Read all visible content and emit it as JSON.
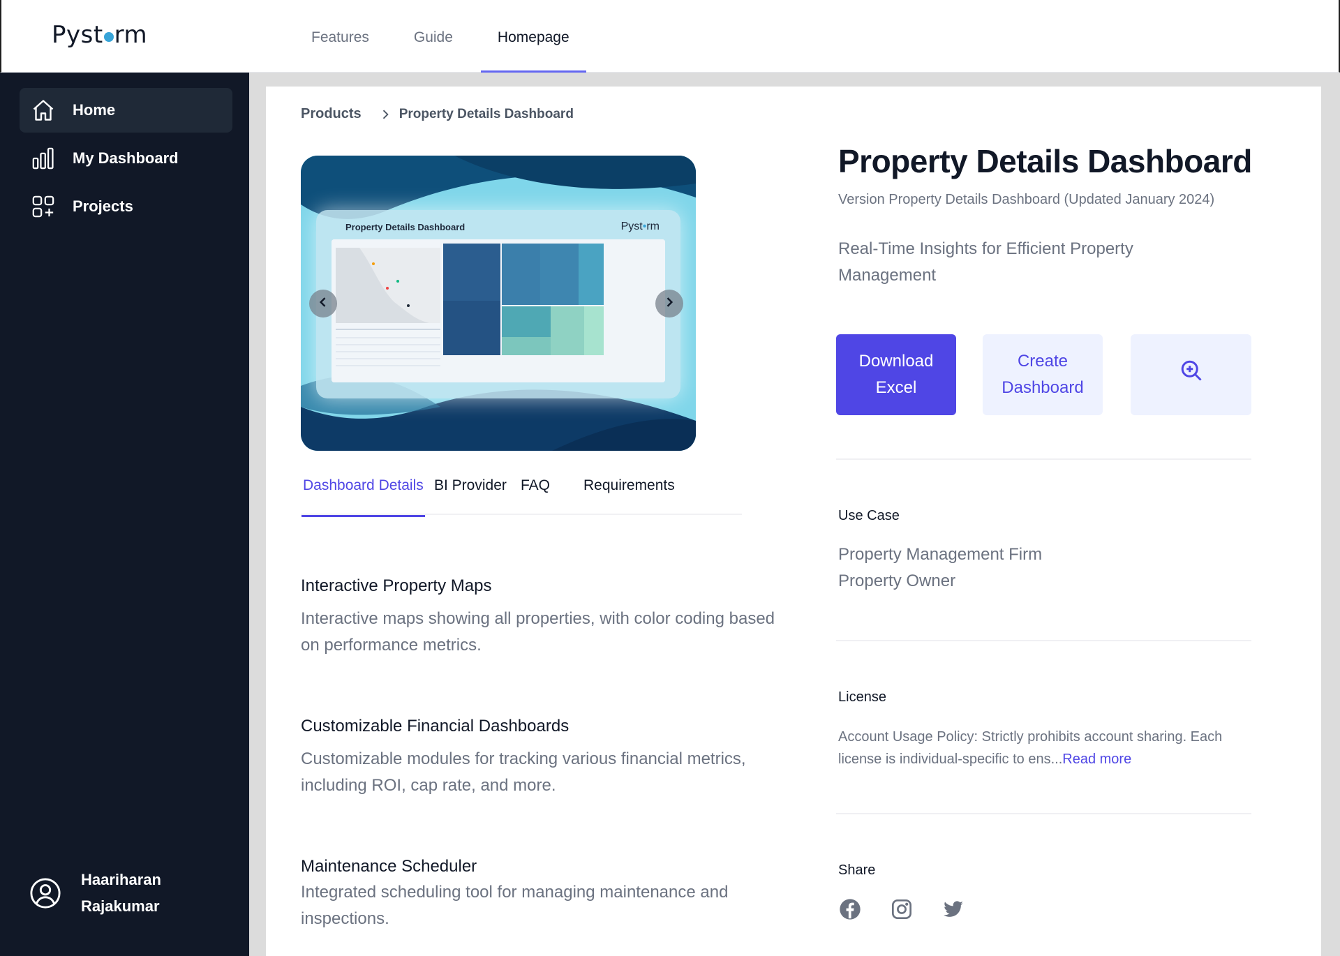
{
  "app": {
    "logo_text_left": "Pyst",
    "logo_text_right": "rm"
  },
  "topnav": {
    "items": [
      {
        "label": "Features"
      },
      {
        "label": "Guide"
      },
      {
        "label": "Homepage"
      }
    ],
    "active": "Homepage"
  },
  "sidebar": {
    "items": [
      {
        "label": "Home",
        "icon": "home-icon",
        "active": true
      },
      {
        "label": "My Dashboard",
        "icon": "bar-chart-icon",
        "active": false
      },
      {
        "label": "Projects",
        "icon": "grid-plus-icon",
        "active": false
      }
    ],
    "user": {
      "first_name": "Haariharan",
      "last_name": "Rajakumar",
      "icon": "user-circle-icon"
    }
  },
  "breadcrumb": {
    "root": "Products",
    "current": "Property Details Dashboard"
  },
  "hero": {
    "preview_title": "Property Details Dashboard",
    "preview_logo_left": "Pyst",
    "preview_logo_right": "rm",
    "icons": [
      "chevron-left-icon",
      "chevron-right-icon"
    ]
  },
  "tabs": [
    {
      "label": "Dashboard Details",
      "active": true
    },
    {
      "label": "BI Provider",
      "active": false
    },
    {
      "label": "FAQ",
      "active": false
    },
    {
      "label": "Requirements",
      "active": false
    }
  ],
  "features": [
    {
      "heading": "Interactive Property Maps",
      "description": "Interactive maps showing all properties, with color coding based on performance metrics."
    },
    {
      "heading": "Customizable Financial Dashboards",
      "description": "Customizable modules for tracking various financial metrics, including ROI, cap rate, and more."
    },
    {
      "heading": "Maintenance Scheduler",
      "description": "Integrated scheduling tool for managing maintenance and inspections."
    }
  ],
  "product": {
    "title": "Property Details Dashboard",
    "version": "Version Property Details Dashboard (Updated January 2024)",
    "tagline": "Real-Time Insights for Efficient Property Management"
  },
  "actions": {
    "download_label": "Download Excel",
    "create_label": "Create Dashboard",
    "zoom_icon": "zoom-in-icon"
  },
  "use_case": {
    "label": "Use Case",
    "items": [
      "Property Management Firm",
      "Property Owner"
    ]
  },
  "license": {
    "label": "License",
    "text": "Account Usage Policy: Strictly prohibits account sharing. Each license is individual-specific to ens...",
    "read_more": "Read more"
  },
  "share": {
    "label": "Share",
    "icons": [
      "facebook-icon",
      "instagram-icon",
      "twitter-icon"
    ]
  },
  "colors": {
    "sidebar_bg": "#111827",
    "accent": "#4f46e5",
    "accent_light": "#eef2ff",
    "logo_dot": "#38a4d8"
  }
}
